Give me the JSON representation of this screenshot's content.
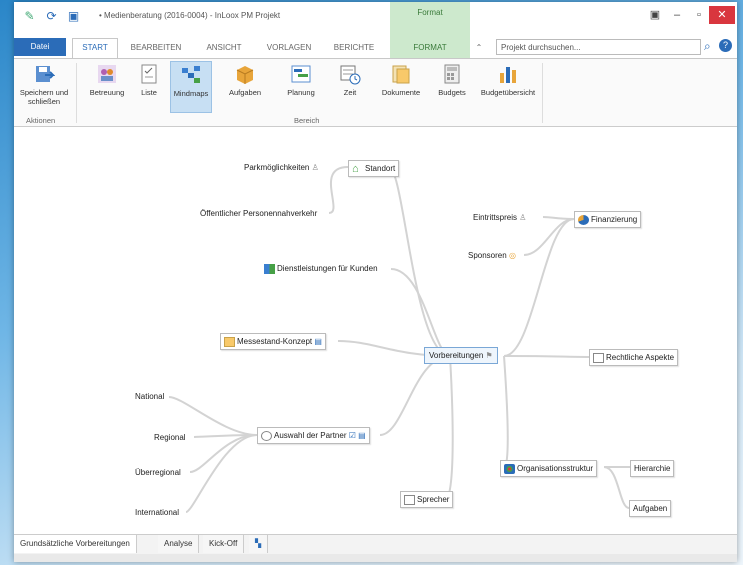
{
  "window": {
    "title": "• Medienberatung (2016-0004) - InLoox PM Projekt",
    "context_tab": "Format"
  },
  "tabs": [
    "Datei",
    "START",
    "BEARBEITEN",
    "ANSICHT",
    "VORLAGEN",
    "BERICHTE",
    "FORMAT"
  ],
  "search": {
    "placeholder": "Projekt durchsuchen..."
  },
  "ribbon": {
    "buttons": [
      {
        "label": "Speichern und schließen",
        "icon": "save-close-icon"
      },
      {
        "label": "Betreuung",
        "icon": "team-icon"
      },
      {
        "label": "Liste",
        "icon": "list-icon"
      },
      {
        "label": "Mindmaps",
        "icon": "mindmap-icon",
        "selected": true
      },
      {
        "label": "Aufgaben",
        "icon": "tasks-icon"
      },
      {
        "label": "Planung",
        "icon": "planning-icon"
      },
      {
        "label": "Zeit",
        "icon": "time-icon"
      },
      {
        "label": "Dokumente",
        "icon": "documents-icon"
      },
      {
        "label": "Budgets",
        "icon": "budgets-icon"
      },
      {
        "label": "Budgetübersicht",
        "icon": "budget-overview-icon"
      }
    ],
    "groups": [
      "Aktionen",
      "Bereich"
    ]
  },
  "mindmap": {
    "center": "Vorbereitungen",
    "nodes": {
      "standort": "Standort",
      "parkmoeglichkeiten": "Parkmöglichkeiten",
      "oepnv": "Öffentlicher Personennahverkehr",
      "dienstleistungen": "Dienstleistungen für Kunden",
      "messestand": "Messestand-Konzept",
      "auswahl": "Auswahl der Partner",
      "national": "National",
      "regional": "Regional",
      "ueberregional": "Überregional",
      "international": "International",
      "sprecher": "Sprecher",
      "finanzierung": "Finanzierung",
      "eintrittspreis": "Eintrittspreis",
      "sponsoren": "Sponsoren",
      "rechtliche": "Rechtliche Aspekte",
      "organisationsstruktur": "Organisationsstruktur",
      "hierarchie": "Hierarchie",
      "aufgaben": "Aufgaben"
    }
  },
  "bottom_tabs": [
    "Grundsätzliche Vorbereitungen",
    "Analyse",
    "Kick-Off"
  ],
  "colors": {
    "accent": "#2b6cb8",
    "context_tab": "#cde9cd",
    "close": "#d9363e"
  }
}
